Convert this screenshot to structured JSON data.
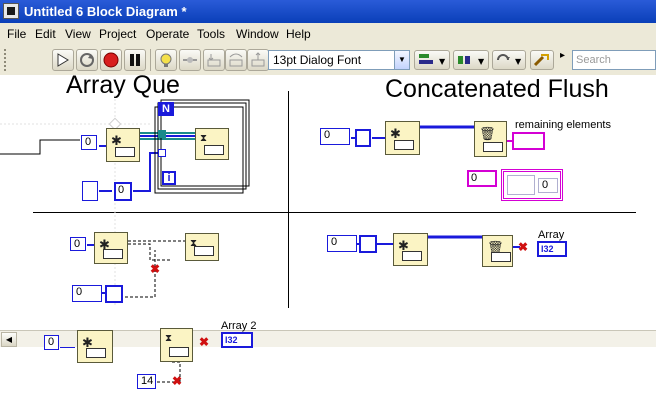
{
  "window": {
    "title": "Untitled 6 Block Diagram *"
  },
  "menu": [
    "File",
    "Edit",
    "View",
    "Project",
    "Operate",
    "Tools",
    "Window",
    "Help"
  ],
  "toolbar": {
    "font_selector": "13pt Dialog Font",
    "search_placeholder": "Search"
  },
  "diagram": {
    "labels": {
      "array_que": "Array Que",
      "concatenated_flush": "Concatenated Flush",
      "remaining_elements": "remaining elements",
      "array": "Array",
      "array2": "Array 2"
    },
    "loop_n": "N",
    "loop_i": "i",
    "constants": {
      "c1": "0",
      "c2": "0",
      "c3": "0",
      "c4": "0",
      "c5": "0",
      "c6": "0",
      "c7": "0",
      "c8": "0",
      "c9": "0",
      "c10": "14"
    },
    "indicator_i32": "I32"
  },
  "colors": {
    "titlebar": "#0a3fb8",
    "wire_blue": "#1a1adb",
    "wire_pink": "#d400d4",
    "node_fill": "#fbf4c4",
    "broken_wire": "#d01010"
  }
}
